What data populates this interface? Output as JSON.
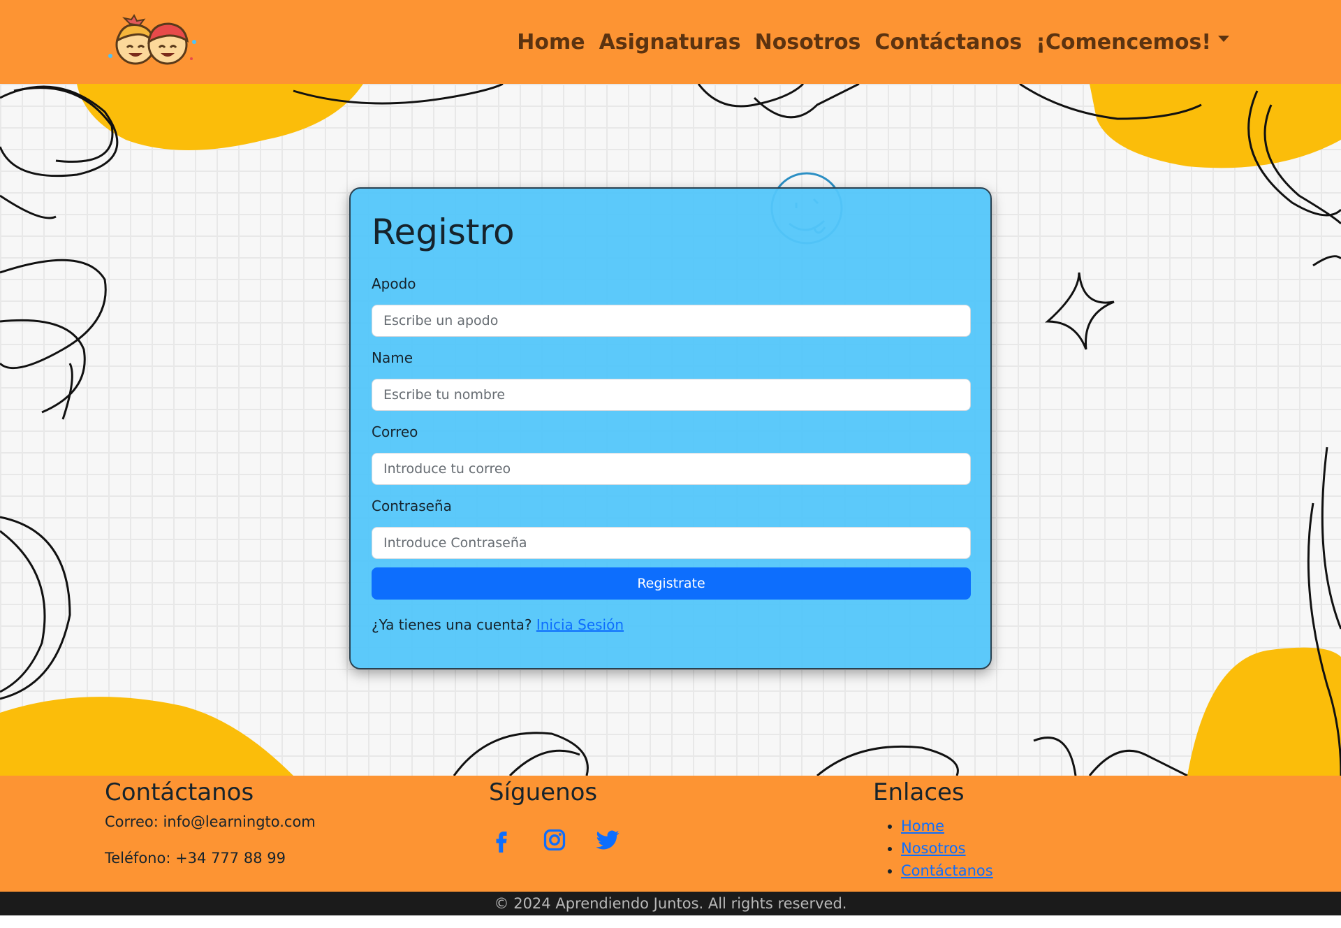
{
  "navbar": {
    "logo_icon": "kids-faces-logo",
    "links": [
      "Home",
      "Asignaturas",
      "Nosotros",
      "Contáctanos",
      "¡Comencemos!"
    ],
    "dropdown_icon": "caret-down-icon"
  },
  "form": {
    "title": "Registro",
    "fields": [
      {
        "label": "Apodo",
        "placeholder": "Escribe un apodo",
        "value": ""
      },
      {
        "label": "Name",
        "placeholder": "Escribe tu nombre",
        "value": ""
      },
      {
        "label": "Correo",
        "placeholder": "Introduce tu correo",
        "value": ""
      },
      {
        "label": "Contraseña",
        "placeholder": "Introduce Contraseña",
        "value": ""
      }
    ],
    "submit_label": "Registrate",
    "login_prompt": "¿Ya tienes una cuenta?",
    "login_link": "Inicia Sesión"
  },
  "footer": {
    "contact": {
      "heading": "Contáctanos",
      "email": "Correo: info@learningto.com",
      "phone": "Teléfono: +34 777 88 99"
    },
    "follow": {
      "heading": "Síguenos",
      "icons": [
        "facebook-icon",
        "instagram-icon",
        "twitter-icon"
      ]
    },
    "links": {
      "heading": "Enlaces",
      "items": [
        "Home",
        "Nosotros",
        "Contáctanos"
      ]
    },
    "copyright": "© 2024 Aprendiendo Juntos. All rights reserved."
  },
  "colors": {
    "navbar_bg": "#fd9433",
    "card_bg": "#53c6fa",
    "primary": "#0d6efd",
    "blob": "#fbbd0a",
    "copyright_bg": "#1b1b1b"
  }
}
